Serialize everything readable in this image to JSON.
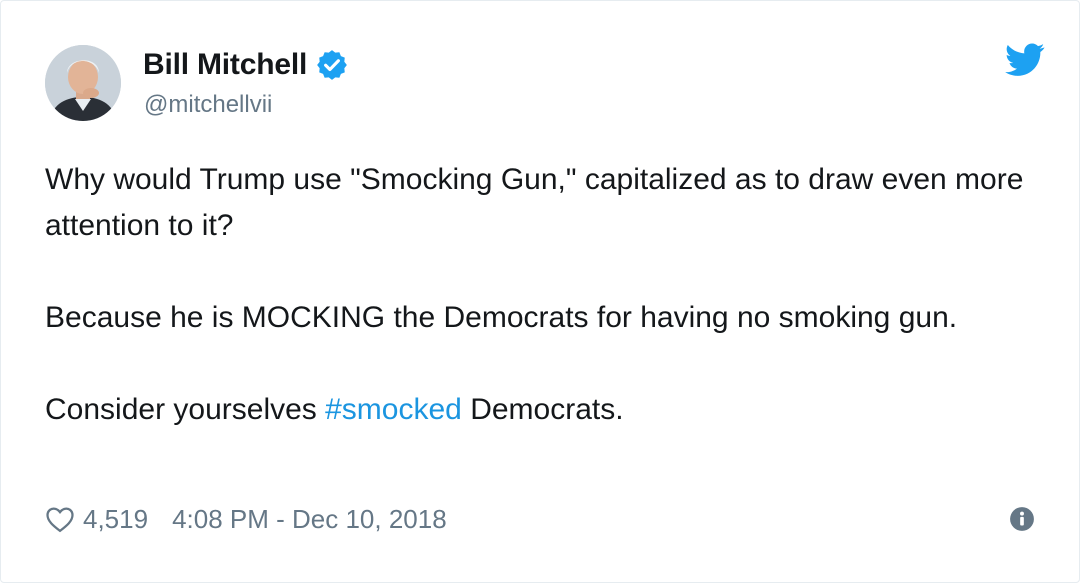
{
  "author": {
    "display_name": "Bill Mitchell",
    "handle": "@mitchellvii",
    "verified": true
  },
  "tweet": {
    "paragraph_1": "Why would Trump use \"Smocking Gun,\" capitalized as to draw even more attention to it?",
    "paragraph_2": "Because he is MOCKING the Democrats for having no smoking gun.",
    "paragraph_3_before": "Consider yourselves ",
    "paragraph_3_hashtag": "#smocked",
    "paragraph_3_after": " Democrats."
  },
  "meta": {
    "like_count": "4,519",
    "timestamp": "4:08 PM - Dec 10, 2018"
  },
  "icons": {
    "verified": "verified-badge-icon",
    "brand": "twitter-bird-icon",
    "like": "heart-icon",
    "info": "info-icon"
  },
  "colors": {
    "brand_blue": "#1da1f2",
    "hashtag": "#1b95e0",
    "secondary_text": "#657786",
    "primary_text": "#14171a"
  }
}
